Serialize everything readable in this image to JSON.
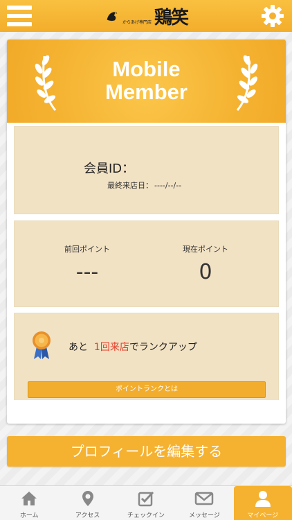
{
  "header": {
    "logo_small": "からあげ専門店",
    "logo_main": "鶏笑"
  },
  "banner": {
    "title_line1": "Mobile",
    "title_line2": "Member"
  },
  "member": {
    "id_label": "会員ID：",
    "id_value": "",
    "last_visit_label": "最終来店日：",
    "last_visit_value": "----/--/--"
  },
  "points": {
    "prev_label": "前回ポイント",
    "prev_value": "---",
    "current_label": "現在ポイント",
    "current_value": "0"
  },
  "rank": {
    "prefix": "あと",
    "count_text": "1回来店",
    "suffix": "でランクアップ",
    "button_label": "ポイントランクとは"
  },
  "edit_profile_label": "プロフィールを編集する",
  "tabs": [
    {
      "label": "ホーム",
      "icon": "home-icon"
    },
    {
      "label": "アクセス",
      "icon": "map-pin-icon"
    },
    {
      "label": "チェックイン",
      "icon": "check-in-icon"
    },
    {
      "label": "メッセージ",
      "icon": "mail-icon"
    },
    {
      "label": "マイページ",
      "icon": "user-icon"
    }
  ],
  "colors": {
    "accent": "#f5b130",
    "panel": "#f2e2c4",
    "highlight_red": "#e23c27"
  }
}
